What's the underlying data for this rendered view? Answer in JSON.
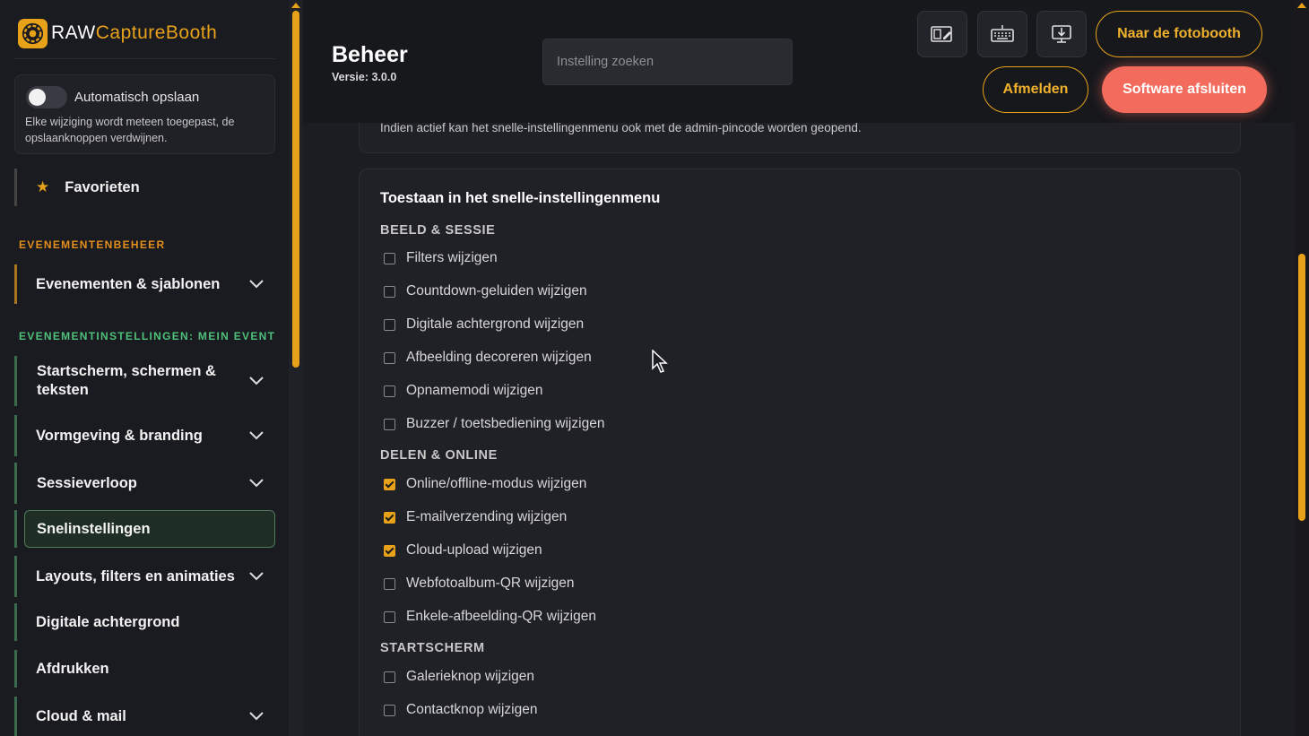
{
  "app": {
    "logo_text_primary": "RAW",
    "logo_text_accent": "CaptureBooth",
    "accent_color": "#e7a21a"
  },
  "sidebar": {
    "autosave": {
      "label": "Automatisch opslaan",
      "enabled": false,
      "description": "Elke wijziging wordt meteen toegepast, de opslaanknoppen verdwijnen."
    },
    "favorites_label": "Favorieten",
    "section_event_mgmt": "EVENEMENTENBEHEER",
    "events_templates": "Evenementen & sjablonen",
    "section_event_settings": "EVENEMENTINSTELLINGEN: MEIN EVENT",
    "items": [
      {
        "label": "Startscherm, schermen & teksten",
        "expandable": true
      },
      {
        "label": "Vormgeving & branding",
        "expandable": true
      },
      {
        "label": "Sessieverloop",
        "expandable": true
      },
      {
        "label": "Snelinstellingen",
        "expandable": false,
        "active": true
      },
      {
        "label": "Layouts, filters en animaties",
        "expandable": true
      },
      {
        "label": "Digitale achtergrond",
        "expandable": false
      },
      {
        "label": "Afdrukken",
        "expandable": false
      },
      {
        "label": "Cloud & mail",
        "expandable": true
      }
    ]
  },
  "header": {
    "title": "Beheer",
    "version": "Versie: 3.0.0",
    "search_placeholder": "Instelling zoeken",
    "icons": [
      "layout-edit-icon",
      "keyboard-icon",
      "monitor-download-icon"
    ],
    "to_photobooth": "Naar de fotobooth",
    "logout": "Afmelden",
    "quit": "Software afsluiten"
  },
  "main": {
    "previous_card_text": "Indien actief kan het snelle-instellingenmenu ook met de admin-pincode worden geopend.",
    "card_title": "Toestaan in het snelle-instellingenmenu",
    "groups": [
      {
        "heading": "BEELD & SESSIE",
        "options": [
          {
            "label": "Filters wijzigen",
            "checked": false
          },
          {
            "label": "Countdown-geluiden wijzigen",
            "checked": false
          },
          {
            "label": "Digitale achtergrond wijzigen",
            "checked": false
          },
          {
            "label": "Afbeelding decoreren wijzigen",
            "checked": false
          },
          {
            "label": "Opnamemodi wijzigen",
            "checked": false
          },
          {
            "label": "Buzzer / toetsbediening wijzigen",
            "checked": false
          }
        ]
      },
      {
        "heading": "DELEN & ONLINE",
        "options": [
          {
            "label": "Online/offline-modus wijzigen",
            "checked": true
          },
          {
            "label": "E-mailverzending wijzigen",
            "checked": true
          },
          {
            "label": "Cloud-upload wijzigen",
            "checked": true
          },
          {
            "label": "Webfotoalbum-QR wijzigen",
            "checked": false
          },
          {
            "label": "Enkele-afbeelding-QR wijzigen",
            "checked": false
          }
        ]
      },
      {
        "heading": "STARTSCHERM",
        "options": [
          {
            "label": "Galerieknop wijzigen",
            "checked": false
          },
          {
            "label": "Contactknop wijzigen",
            "checked": false
          }
        ]
      }
    ]
  }
}
